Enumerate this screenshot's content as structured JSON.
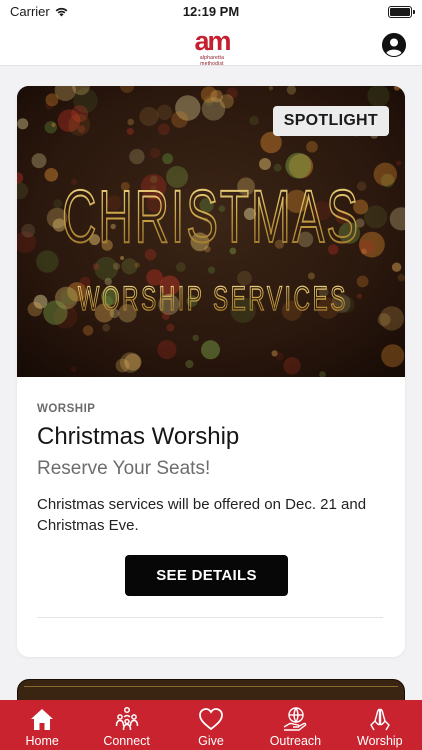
{
  "status_bar": {
    "carrier": "Carrier",
    "time": "12:19 PM"
  },
  "header": {
    "logo_mark": "am",
    "logo_text": "alpharetta methodist"
  },
  "spotlight_card": {
    "badge": "SPOTLIGHT",
    "image_text_line1": "CHRISTMAS",
    "image_text_line2": "WORSHIP SERVICES",
    "category": "WORSHIP",
    "title": "Christmas Worship",
    "subtitle": "Reserve Your Seats!",
    "description": "Christmas services will be offered on Dec. 21 and Christmas Eve.",
    "button_label": "SEE DETAILS"
  },
  "tabs": [
    {
      "label": "Home",
      "icon": "home-icon"
    },
    {
      "label": "Connect",
      "icon": "connect-icon"
    },
    {
      "label": "Give",
      "icon": "heart-icon"
    },
    {
      "label": "Outreach",
      "icon": "globe-hand-icon"
    },
    {
      "label": "Worship",
      "icon": "praying-hands-icon"
    }
  ],
  "colors": {
    "brand_red": "#c8232e",
    "logo_red": "#c4202e",
    "button_black": "#070707",
    "gold": "#d4b25a"
  }
}
